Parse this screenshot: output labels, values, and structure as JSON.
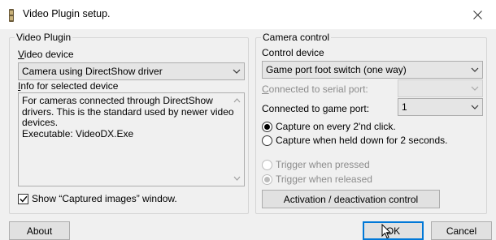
{
  "window": {
    "title": "Video Plugin setup."
  },
  "video_plugin": {
    "group_title": "Video Plugin",
    "video_device_label": "Video device",
    "video_device_value": "Camera using DirectShow driver",
    "info_label": "Info for selected device",
    "info_lines": [
      "For cameras connected through DirectShow",
      "drivers. This is the standard used by newer video",
      "devices.",
      "Executable: VideoDX.Exe"
    ],
    "show_captured_label": "Show “Captured images” window.",
    "show_captured_checked": true
  },
  "camera_control": {
    "group_title": "Camera control",
    "control_device_label": "Control device",
    "control_device_value": "Game port foot switch (one way)",
    "serial_port_label": "Connected to serial port:",
    "serial_port_value": "",
    "game_port_label": "Connected to game port:",
    "game_port_value": "1",
    "capture_every_label": "Capture on every 2'nd click.",
    "capture_held_label": "Capture when held down for 2 seconds.",
    "capture_mode_selected": "every",
    "trigger_pressed_label": "Trigger when pressed",
    "trigger_released_label": "Trigger when released",
    "trigger_selected": "released",
    "activation_button_label": "Activation / deactivation control"
  },
  "buttons": {
    "about": "About",
    "ok": "OK",
    "cancel": "Cancel"
  },
  "colors": {
    "accent": "#0078d7",
    "dialog_bg": "#f0f0f0",
    "disabled_text": "#8c8c8c"
  }
}
